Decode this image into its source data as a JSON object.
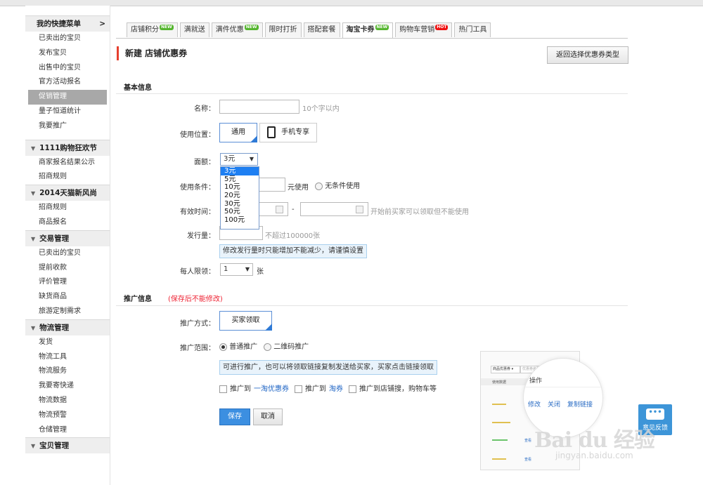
{
  "sidebar": {
    "quick_menu": {
      "title": "我的快捷菜单",
      "toggle": ">",
      "items": [
        "已卖出的宝贝",
        "发布宝贝",
        "出售中的宝贝",
        "官方活动报名",
        "促销管理",
        "量子恒道统计",
        "我要推广"
      ],
      "active": "促销管理"
    },
    "sections": [
      {
        "title": "1111购物狂欢节",
        "items": [
          "商家报名结果公示",
          "招商规则"
        ]
      },
      {
        "title": "2014天猫新风尚",
        "items": [
          "招商规则",
          "商品报名"
        ]
      },
      {
        "title": "交易管理",
        "items": [
          "已卖出的宝贝",
          "提前收款",
          "评价管理",
          "缺货商品",
          "旅游定制需求"
        ]
      },
      {
        "title": "物流管理",
        "items": [
          "发货",
          "物流工具",
          "物流服务",
          "我要寄快递",
          "物流数据",
          "物流预警",
          "仓储管理"
        ]
      },
      {
        "title": "宝贝管理",
        "items": []
      }
    ]
  },
  "tabs": [
    {
      "label": "店铺积分",
      "badge": "NEW",
      "badge_type": "new"
    },
    {
      "label": "满就送",
      "badge": "",
      "badge_type": ""
    },
    {
      "label": "满件优惠",
      "badge": "NEW",
      "badge_type": "new"
    },
    {
      "label": "限时打折",
      "badge": "",
      "badge_type": ""
    },
    {
      "label": "搭配套餐",
      "badge": "",
      "badge_type": ""
    },
    {
      "label": "淘宝卡券",
      "badge": "NEW",
      "badge_type": "new",
      "active": true
    },
    {
      "label": "购物车营销",
      "badge": "HOT",
      "badge_type": "hot"
    },
    {
      "label": "热门工具",
      "badge": "",
      "badge_type": ""
    }
  ],
  "page": {
    "title": "新建 店铺优惠券",
    "back_button": "返回选择优惠券类型"
  },
  "basic": {
    "section_title": "基本信息",
    "name": {
      "label": "名称：",
      "value": "",
      "hint": "10个字以内"
    },
    "position": {
      "label": "使用位置：",
      "general": "通用",
      "mobile": "手机专享"
    },
    "denomination": {
      "label": "面额：",
      "selected": "3元",
      "options": [
        "3元",
        "5元",
        "10元",
        "20元",
        "30元",
        "50元",
        "100元"
      ]
    },
    "condition": {
      "label": "使用条件：",
      "unit": "元使用",
      "none": "无条件使用"
    },
    "validity": {
      "label": "有效时间：",
      "dash": "-",
      "hint": "开始前买家可以领取但不能使用"
    },
    "quantity": {
      "label": "发行量：",
      "hint": "不超过100000张",
      "notice": "修改发行量时只能增加不能减少，请谨慎设置"
    },
    "limit": {
      "label": "每人限领：",
      "value": "1",
      "unit": "张"
    }
  },
  "promo": {
    "section_title": "推广信息",
    "warning": "(保存后不能修改)",
    "method": {
      "label": "推广方式：",
      "value": "买家领取"
    },
    "range": {
      "label": "推广范围：",
      "normal": "普通推广",
      "qrcode": "二维码推广"
    },
    "notice": "可进行推广，也可以将领取链接复制发送给买家，买家点击链接领取",
    "channels": [
      {
        "prefix": "推广到",
        "link": "一淘优惠券"
      },
      {
        "prefix": "推广到",
        "link": "淘券"
      },
      {
        "prefix": "推广到店铺搜，购物车等",
        "link": ""
      }
    ]
  },
  "actions": {
    "save": "保存",
    "cancel": "取消"
  },
  "preview": {
    "filter": "商品优惠券 ▾",
    "search": "优惠券名称",
    "col1": "使用数据",
    "col2": "操作",
    "ops": [
      "修改",
      "关闭",
      "复制链接"
    ],
    "row_op": "查看"
  },
  "feedback": {
    "icon": "•••",
    "label": "意见反馈"
  },
  "watermark": {
    "brand": "Bai du 经验",
    "url": "jingyan.baidu.com"
  }
}
